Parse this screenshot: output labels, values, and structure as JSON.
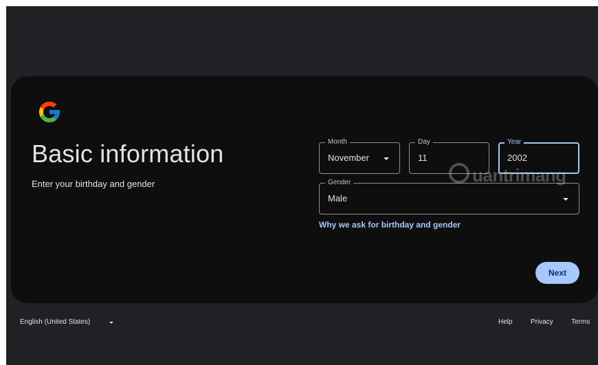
{
  "brand": {
    "logo_icon": "google-g-icon",
    "colors": {
      "blue": "#4285F4",
      "red": "#EA4335",
      "yellow": "#FBBC05",
      "green": "#34A853"
    }
  },
  "header": {
    "title": "Basic information",
    "subtitle": "Enter your birthday and gender"
  },
  "form": {
    "month": {
      "label": "Month",
      "value": "November"
    },
    "day": {
      "label": "Day",
      "value": "11"
    },
    "year": {
      "label": "Year",
      "value": "2002"
    },
    "gender": {
      "label": "Gender",
      "value": "Male"
    },
    "help_link": "Why we ask for birthday and gender",
    "next_label": "Next"
  },
  "watermark": {
    "text": "uantrimang"
  },
  "footer": {
    "language": "English (United States)",
    "links": [
      "Help",
      "Privacy",
      "Terms"
    ]
  },
  "theme": {
    "background": "#202124",
    "card": "#0e0e0f",
    "accent": "#a8c7fa",
    "text": "#e3e3e3"
  }
}
